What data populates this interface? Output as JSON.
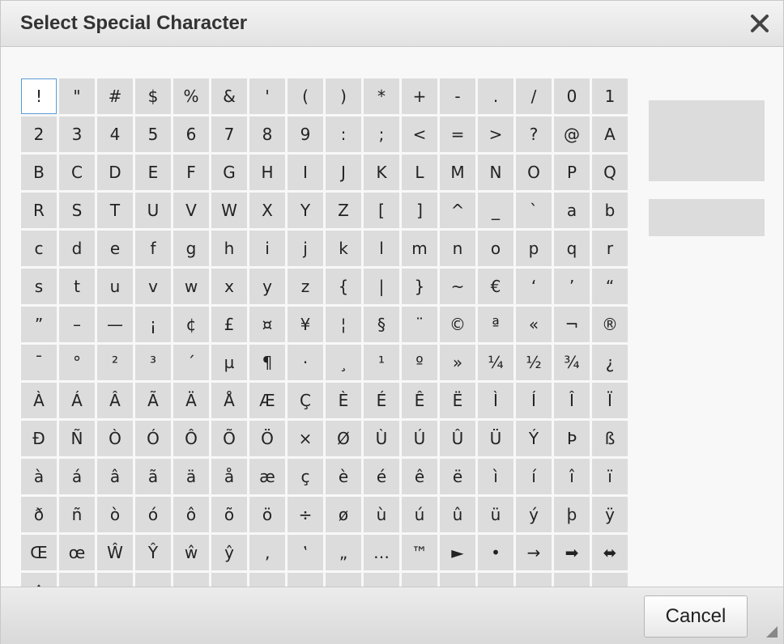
{
  "dialog": {
    "title": "Select Special Character",
    "close_icon": "close-icon",
    "cancel_label": "Cancel",
    "resize_icon": "resize-grip-icon"
  },
  "characters": [
    "!",
    "\"",
    "#",
    "$",
    "%",
    "&",
    "'",
    "(",
    ")",
    "*",
    "+",
    "-",
    ".",
    "/",
    "0",
    "1",
    "2",
    "3",
    "4",
    "5",
    "6",
    "7",
    "8",
    "9",
    ":",
    ";",
    "<",
    "=",
    ">",
    "?",
    "@",
    "A",
    "B",
    "C",
    "D",
    "E",
    "F",
    "G",
    "H",
    "I",
    "J",
    "K",
    "L",
    "M",
    "N",
    "O",
    "P",
    "Q",
    "R",
    "S",
    "T",
    "U",
    "V",
    "W",
    "X",
    "Y",
    "Z",
    "[",
    "]",
    "^",
    "_",
    "`",
    "a",
    "b",
    "c",
    "d",
    "e",
    "f",
    "g",
    "h",
    "i",
    "j",
    "k",
    "l",
    "m",
    "n",
    "o",
    "p",
    "q",
    "r",
    "s",
    "t",
    "u",
    "v",
    "w",
    "x",
    "y",
    "z",
    "{",
    "|",
    "}",
    "~",
    "€",
    "‘",
    "’",
    "“",
    "”",
    "–",
    "—",
    "¡",
    "¢",
    "£",
    "¤",
    "¥",
    "¦",
    "§",
    "¨",
    "©",
    "ª",
    "«",
    "¬",
    "®",
    "¯",
    "°",
    "²",
    "³",
    "´",
    "µ",
    "¶",
    "·",
    "¸",
    "¹",
    "º",
    "»",
    "¼",
    "½",
    "¾",
    "¿",
    "À",
    "Á",
    "Â",
    "Ã",
    "Ä",
    "Å",
    "Æ",
    "Ç",
    "È",
    "É",
    "Ê",
    "Ë",
    "Ì",
    "Í",
    "Î",
    "Ï",
    "Ð",
    "Ñ",
    "Ò",
    "Ó",
    "Ô",
    "Õ",
    "Ö",
    "×",
    "Ø",
    "Ù",
    "Ú",
    "Û",
    "Ü",
    "Ý",
    "Þ",
    "ß",
    "à",
    "á",
    "â",
    "ã",
    "ä",
    "å",
    "æ",
    "ç",
    "è",
    "é",
    "ê",
    "ë",
    "ì",
    "í",
    "î",
    "ï",
    "ð",
    "ñ",
    "ò",
    "ó",
    "ô",
    "õ",
    "ö",
    "÷",
    "ø",
    "ù",
    "ú",
    "û",
    "ü",
    "ý",
    "þ",
    "ÿ",
    "Œ",
    "œ",
    "Ŵ",
    "Ŷ",
    "ŵ",
    "ŷ",
    "‚",
    "‛",
    "„",
    "…",
    "™",
    "►",
    "•",
    "→",
    "➡",
    "⬌",
    "♦",
    "≈"
  ],
  "selected_index": 0,
  "total_cells": 224
}
